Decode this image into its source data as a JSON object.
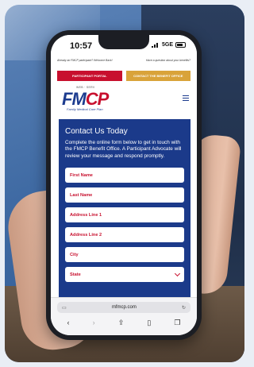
{
  "status": {
    "time": "10:57",
    "network": "5GE"
  },
  "site": {
    "top_left_text": "Already an FMCP participant? Welcome Back!",
    "top_right_text": "Have a question about your benefits?",
    "portal_button": "PARTICIPANT PORTAL",
    "contact_button": "CONTACT THE BENEFIT OFFICE",
    "logo_tagline_top": "WEB · SERV",
    "logo_word_a": "FM",
    "logo_word_b": "CP",
    "logo_tagline_bottom": "Family Medical Care Plan"
  },
  "form": {
    "title": "Contact Us Today",
    "description": "Complete the online form below to get in touch with the FMCP Benefit Office. A Participant Advocate will review your message and respond promptly.",
    "fields": [
      "First Name",
      "Last Name",
      "Address Line 1",
      "Address Line 2",
      "City",
      "State"
    ]
  },
  "browser": {
    "url": "mfmcp.com"
  },
  "colors": {
    "brand_blue": "#1b3a8a",
    "brand_red": "#c8102e",
    "gold": "#d9a33a"
  }
}
